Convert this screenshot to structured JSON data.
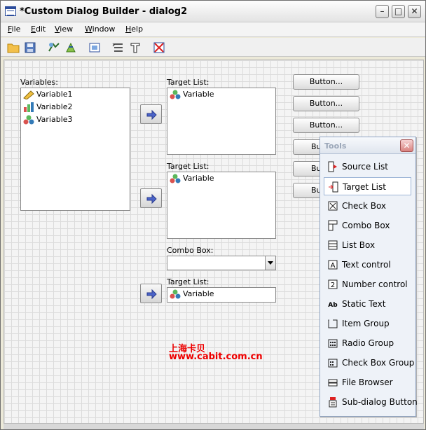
{
  "window": {
    "title": "*Custom Dialog Builder - dialog2",
    "controls": [
      "minimize",
      "maximize",
      "close"
    ]
  },
  "menubar": [
    {
      "first": "F",
      "rest": "ile"
    },
    {
      "first": "E",
      "rest": "dit"
    },
    {
      "first": "V",
      "rest": "iew"
    },
    {
      "first": "W",
      "rest": "indow"
    },
    {
      "first": "H",
      "rest": "elp"
    }
  ],
  "toolbar": [
    "open-folder-icon",
    "save-icon",
    "preview-icon",
    "install-icon",
    "properties-icon",
    "tab-order-icon",
    "tool-icon",
    "close-dialog-icon"
  ],
  "canvas": {
    "variables_label": "Variables:",
    "variables": [
      {
        "name": "Variable1",
        "icon": "ruler-icon"
      },
      {
        "name": "Variable2",
        "icon": "bar-icon"
      },
      {
        "name": "Variable3",
        "icon": "nominal-icon"
      }
    ],
    "target_lists": [
      {
        "label": "Target List:",
        "item": "Variable"
      },
      {
        "label": "Target List:",
        "item": "Variable"
      },
      {
        "label": "Target List:",
        "item": "Variable"
      }
    ],
    "combo_label": "Combo Box:",
    "combo_value": "",
    "buttons": [
      "Button...",
      "Button...",
      "Button...",
      "Bu",
      "Bu",
      "Bu"
    ]
  },
  "watermark": {
    "line1": "上海卡贝",
    "line2": "www.cabit.com.cn"
  },
  "tools": {
    "title": "Tools",
    "items": [
      {
        "label": "Source List",
        "icon": "source-list-icon"
      },
      {
        "label": "Target List",
        "icon": "target-list-icon",
        "selected": true
      },
      {
        "label": "Check Box",
        "icon": "check-box-icon"
      },
      {
        "label": "Combo Box",
        "icon": "combo-box-icon"
      },
      {
        "label": "List Box",
        "icon": "list-box-icon"
      },
      {
        "label": "Text control",
        "icon": "text-control-icon"
      },
      {
        "label": "Number control",
        "icon": "number-control-icon"
      },
      {
        "label": "Static Text",
        "icon": "static-text-icon"
      },
      {
        "label": "Item Group",
        "icon": "item-group-icon"
      },
      {
        "label": "Radio Group",
        "icon": "radio-group-icon"
      },
      {
        "label": "Check Box Group",
        "icon": "check-box-group-icon"
      },
      {
        "label": "File Browser",
        "icon": "file-browser-icon"
      },
      {
        "label": "Sub-dialog Button",
        "icon": "sub-dialog-button-icon"
      }
    ]
  }
}
